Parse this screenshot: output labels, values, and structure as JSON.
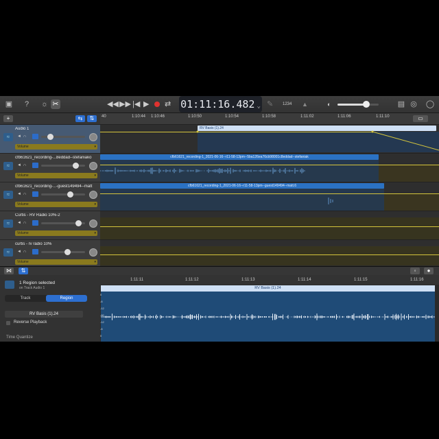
{
  "toolbar": {
    "lcd": "01:11:16.482",
    "lcd_chevron": "⌄",
    "icons": [
      "library-icon",
      "help-icon",
      "settings-icon",
      "scissors-icon",
      "rewind-icon",
      "forward-icon",
      "to-start-icon",
      "play-icon",
      "record-icon",
      "cycle-icon",
      "tuner-icon",
      "count-in-icon",
      "volume-icon",
      "notepad-icon",
      "loops-icon",
      "browser-icon"
    ],
    "count_in": "1234",
    "volume_level": 0.7
  },
  "tracks_header": {
    "add_label": "+",
    "tracks": [
      {
        "name": "Audio 1",
        "automation": "Volume",
        "fader": 0.2,
        "selected": true
      },
      {
        "name": "cfb61621_recording-...8eddad--stefaniako",
        "automation": "Volume",
        "fader": 0.78,
        "selected": false
      },
      {
        "name": "cfb61621_recording-...-guest149494--matt",
        "automation": "Volume",
        "fader": 0.65,
        "selected": false
      },
      {
        "name": "Curtis - RV Radio 10%-2",
        "automation": "Volume",
        "fader": 0.85,
        "selected": false
      },
      {
        "name": "curtis - rv radio 10%",
        "automation": "Volume",
        "fader": 0.6,
        "selected": false
      }
    ]
  },
  "ruler": {
    "ticks": [
      "40",
      "1:10:44",
      "1:10:46",
      "1:10:50",
      "1:10:54",
      "1:10:58",
      "1:11:02",
      "1:11:06",
      "1:11:10"
    ]
  },
  "regions": {
    "rv_basis": "RV Basis (1).24",
    "stefaniak": "cfb61621_recording-1_2021-06-16--r11-58-13pm--5ba126ea76cb98001c8eddad--stefaniak",
    "matt": "cfb61621_recording-1_2021-06-16--r11-58-13pm--guest149494--matt.6"
  },
  "editor": {
    "selected_title": "1 Region selected",
    "selected_sub": "on Track Audio 1",
    "tab_track": "Track",
    "tab_region": "Region",
    "region_name": "RV Basis (1).24",
    "reverse_playback": "Reverse Playback",
    "time_quantize": "Time Quantize",
    "ruler_ticks": [
      "1:11:11",
      "1:11:12",
      "1:11:13",
      "1:11:14",
      "1:11:15",
      "1:11:16"
    ],
    "region_header": "RV Basis (1).24",
    "scale": [
      "0",
      "-6",
      "-12",
      "-60",
      "-12",
      "-6",
      "0"
    ]
  },
  "colors": {
    "accent": "#2d6fd0",
    "region_blue": "#2b72c3",
    "automation_yellow": "#d6c63c",
    "record_red": "#e0322f"
  }
}
